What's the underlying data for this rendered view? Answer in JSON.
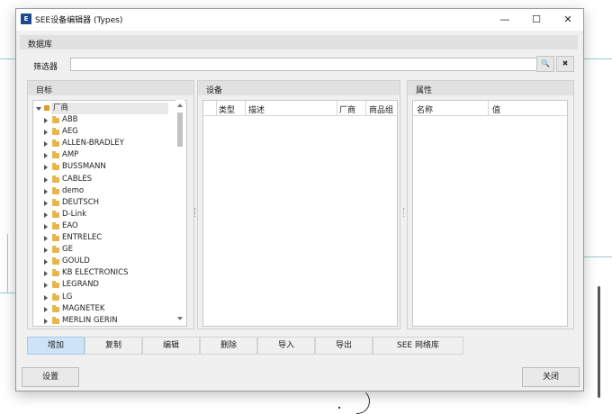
{
  "window": {
    "title": "SEE设备编辑器 (Types)",
    "minimize": "—",
    "maximize": "☐",
    "close": "✕"
  },
  "database": {
    "header": "数据库"
  },
  "filter": {
    "label": "筛选器",
    "value": "",
    "search_icon": "search-icon",
    "clear_icon": "clear-icon",
    "search_glyph": "🔍",
    "clear_glyph": "✖"
  },
  "target_panel": {
    "header": "目标",
    "root": "厂商",
    "items": [
      "ABB",
      "AEG",
      "ALLEN-BRADLEY",
      "AMP",
      "BUSSMANN",
      "CABLES",
      "demo",
      "DEUTSCH",
      "D-Link",
      "EAO",
      "ENTRELEC",
      "GE",
      "GOULD",
      "KB ELECTRONICS",
      "LEGRAND",
      "LG",
      "MAGNETEK",
      "MERLIN GERIN"
    ]
  },
  "device_panel": {
    "header": "设备",
    "columns": [
      "类型",
      "描述",
      "厂商",
      "商品组"
    ]
  },
  "property_panel": {
    "header": "属性",
    "columns": [
      "名称",
      "值"
    ]
  },
  "actions": [
    "增加",
    "复制",
    "编辑",
    "删除",
    "导入",
    "导出",
    "SEE 网络库"
  ],
  "footer": {
    "settings": "设置",
    "close": "关闭"
  },
  "colors": {
    "active_tab": "#cde3f7",
    "folder": "#e8b54a"
  }
}
